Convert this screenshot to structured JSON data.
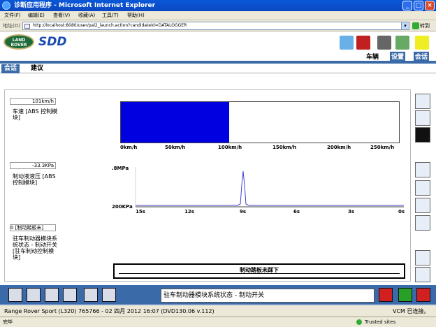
{
  "window": {
    "title": "诊断应用程序 - Microsoft Internet Explorer"
  },
  "menu": [
    "文件(F)",
    "编辑(E)",
    "查看(V)",
    "收藏(A)",
    "工具(T)",
    "帮助(H)"
  ],
  "address": {
    "label": "地址(D)",
    "url": "http://localhost:8080/user/pal2_launch.action?candidateId=DATALOGGER",
    "go": "转到"
  },
  "brand": {
    "logo_top": "LAND",
    "logo_bottom": "ROVER",
    "app": "SDD"
  },
  "nav": {
    "vehicle": "车辆",
    "settings": "设置",
    "session": "会话"
  },
  "tabs": {
    "session": "会话",
    "recommend": "建议"
  },
  "params": [
    {
      "value": "101km/h",
      "label": "车速 [ABS 控制模块]"
    },
    {
      "value": "-33.3KPa",
      "label": "制动液液压 [ABS 控制模块]"
    },
    {
      "value": "0 [制动踏板未]",
      "label": "驻车制动器模块系统状态 - 制动开关 [驻车制动控制模块]"
    }
  ],
  "speed": {
    "value_kmh": 101,
    "max_kmh": 260,
    "ticks": [
      "0km/h",
      "50km/h",
      "100km/h",
      "150km/h",
      "200km/h",
      "250km/h"
    ]
  },
  "pressure_chart": {
    "y_top": ".8MPa",
    "y_bottom": "200KPa",
    "x_ticks": [
      "15s",
      "12s",
      "9s",
      "6s",
      "3s",
      "0s"
    ]
  },
  "brake_state": "制动踏板未踩下",
  "status_text": "驻车制动器模块系统状态 - 制动开关",
  "info": {
    "vehicle": "Range Rover Sport (L320) 765766 - 02 四月 2012 16:07 (DVD130.06 v.112)",
    "vcm": "VCM 已连接。"
  },
  "ie_status": {
    "left": "完毕",
    "right": "Trusted sites"
  },
  "colors": {
    "accent": "#3b6aa8",
    "speed_fill": "#0000e0",
    "titlebar": "#0a58d8"
  }
}
